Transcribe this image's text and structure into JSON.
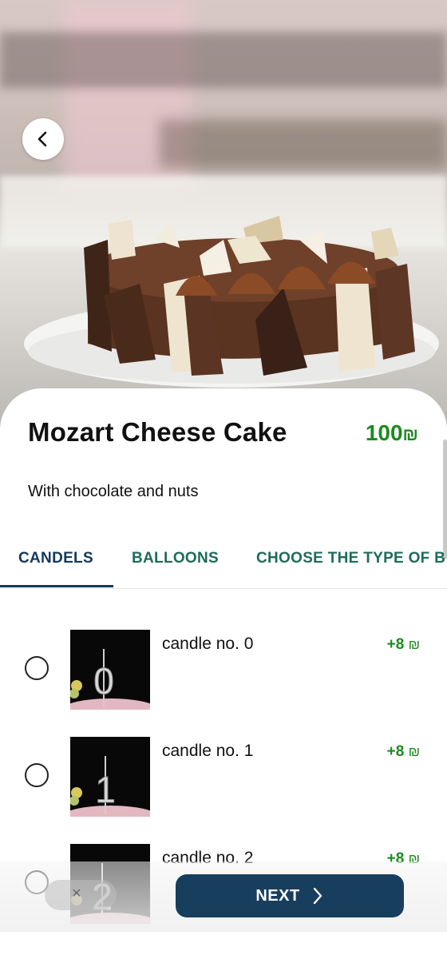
{
  "product": {
    "name": "Mozart Cheese Cake",
    "price": "100",
    "currency": "₪",
    "description": "With chocolate and nuts"
  },
  "tabs": [
    {
      "label": "CANDELS",
      "active": true
    },
    {
      "label": "BALLOONS",
      "active": false
    },
    {
      "label": "CHOOSE THE TYPE OF B",
      "active": false
    }
  ],
  "options": [
    {
      "name": "candle no. 0",
      "price": "+8",
      "currency": "₪",
      "digit": "0",
      "selected": false
    },
    {
      "name": "candle no. 1",
      "price": "+8",
      "currency": "₪",
      "digit": "1",
      "selected": false
    },
    {
      "name": "candle no. 2",
      "price": "+8",
      "currency": "₪",
      "digit": "2",
      "selected": false
    }
  ],
  "footer": {
    "quantity_symbol": "×",
    "next_label": "NEXT"
  },
  "colors": {
    "accent": "#183e5e",
    "price_green": "#1c8a1f",
    "tab_text": "#1f6b5b"
  },
  "icons": {
    "back": "chevron-left-icon",
    "next": "chevron-right-icon"
  }
}
